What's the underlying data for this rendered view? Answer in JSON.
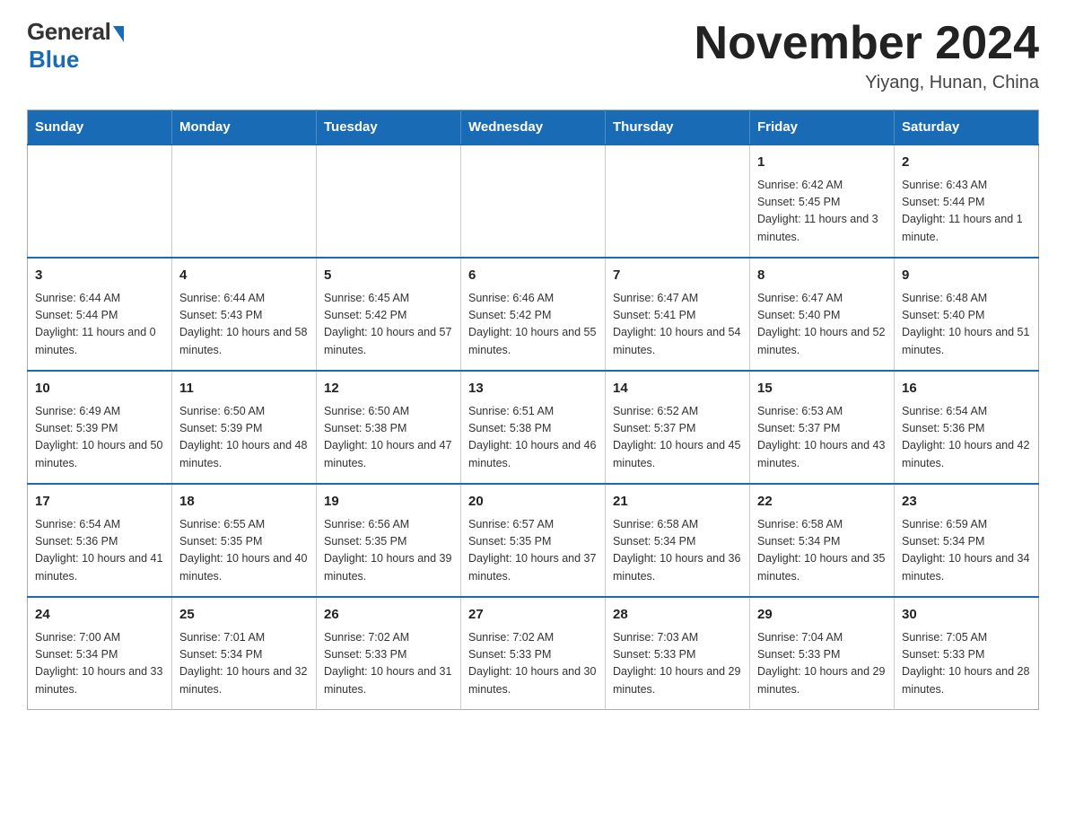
{
  "header": {
    "logo_general": "General",
    "logo_blue": "Blue",
    "month_title": "November 2024",
    "location": "Yiyang, Hunan, China"
  },
  "weekdays": [
    "Sunday",
    "Monday",
    "Tuesday",
    "Wednesday",
    "Thursday",
    "Friday",
    "Saturday"
  ],
  "weeks": [
    [
      {
        "day": "",
        "info": ""
      },
      {
        "day": "",
        "info": ""
      },
      {
        "day": "",
        "info": ""
      },
      {
        "day": "",
        "info": ""
      },
      {
        "day": "",
        "info": ""
      },
      {
        "day": "1",
        "info": "Sunrise: 6:42 AM\nSunset: 5:45 PM\nDaylight: 11 hours and 3 minutes."
      },
      {
        "day": "2",
        "info": "Sunrise: 6:43 AM\nSunset: 5:44 PM\nDaylight: 11 hours and 1 minute."
      }
    ],
    [
      {
        "day": "3",
        "info": "Sunrise: 6:44 AM\nSunset: 5:44 PM\nDaylight: 11 hours and 0 minutes."
      },
      {
        "day": "4",
        "info": "Sunrise: 6:44 AM\nSunset: 5:43 PM\nDaylight: 10 hours and 58 minutes."
      },
      {
        "day": "5",
        "info": "Sunrise: 6:45 AM\nSunset: 5:42 PM\nDaylight: 10 hours and 57 minutes."
      },
      {
        "day": "6",
        "info": "Sunrise: 6:46 AM\nSunset: 5:42 PM\nDaylight: 10 hours and 55 minutes."
      },
      {
        "day": "7",
        "info": "Sunrise: 6:47 AM\nSunset: 5:41 PM\nDaylight: 10 hours and 54 minutes."
      },
      {
        "day": "8",
        "info": "Sunrise: 6:47 AM\nSunset: 5:40 PM\nDaylight: 10 hours and 52 minutes."
      },
      {
        "day": "9",
        "info": "Sunrise: 6:48 AM\nSunset: 5:40 PM\nDaylight: 10 hours and 51 minutes."
      }
    ],
    [
      {
        "day": "10",
        "info": "Sunrise: 6:49 AM\nSunset: 5:39 PM\nDaylight: 10 hours and 50 minutes."
      },
      {
        "day": "11",
        "info": "Sunrise: 6:50 AM\nSunset: 5:39 PM\nDaylight: 10 hours and 48 minutes."
      },
      {
        "day": "12",
        "info": "Sunrise: 6:50 AM\nSunset: 5:38 PM\nDaylight: 10 hours and 47 minutes."
      },
      {
        "day": "13",
        "info": "Sunrise: 6:51 AM\nSunset: 5:38 PM\nDaylight: 10 hours and 46 minutes."
      },
      {
        "day": "14",
        "info": "Sunrise: 6:52 AM\nSunset: 5:37 PM\nDaylight: 10 hours and 45 minutes."
      },
      {
        "day": "15",
        "info": "Sunrise: 6:53 AM\nSunset: 5:37 PM\nDaylight: 10 hours and 43 minutes."
      },
      {
        "day": "16",
        "info": "Sunrise: 6:54 AM\nSunset: 5:36 PM\nDaylight: 10 hours and 42 minutes."
      }
    ],
    [
      {
        "day": "17",
        "info": "Sunrise: 6:54 AM\nSunset: 5:36 PM\nDaylight: 10 hours and 41 minutes."
      },
      {
        "day": "18",
        "info": "Sunrise: 6:55 AM\nSunset: 5:35 PM\nDaylight: 10 hours and 40 minutes."
      },
      {
        "day": "19",
        "info": "Sunrise: 6:56 AM\nSunset: 5:35 PM\nDaylight: 10 hours and 39 minutes."
      },
      {
        "day": "20",
        "info": "Sunrise: 6:57 AM\nSunset: 5:35 PM\nDaylight: 10 hours and 37 minutes."
      },
      {
        "day": "21",
        "info": "Sunrise: 6:58 AM\nSunset: 5:34 PM\nDaylight: 10 hours and 36 minutes."
      },
      {
        "day": "22",
        "info": "Sunrise: 6:58 AM\nSunset: 5:34 PM\nDaylight: 10 hours and 35 minutes."
      },
      {
        "day": "23",
        "info": "Sunrise: 6:59 AM\nSunset: 5:34 PM\nDaylight: 10 hours and 34 minutes."
      }
    ],
    [
      {
        "day": "24",
        "info": "Sunrise: 7:00 AM\nSunset: 5:34 PM\nDaylight: 10 hours and 33 minutes."
      },
      {
        "day": "25",
        "info": "Sunrise: 7:01 AM\nSunset: 5:34 PM\nDaylight: 10 hours and 32 minutes."
      },
      {
        "day": "26",
        "info": "Sunrise: 7:02 AM\nSunset: 5:33 PM\nDaylight: 10 hours and 31 minutes."
      },
      {
        "day": "27",
        "info": "Sunrise: 7:02 AM\nSunset: 5:33 PM\nDaylight: 10 hours and 30 minutes."
      },
      {
        "day": "28",
        "info": "Sunrise: 7:03 AM\nSunset: 5:33 PM\nDaylight: 10 hours and 29 minutes."
      },
      {
        "day": "29",
        "info": "Sunrise: 7:04 AM\nSunset: 5:33 PM\nDaylight: 10 hours and 29 minutes."
      },
      {
        "day": "30",
        "info": "Sunrise: 7:05 AM\nSunset: 5:33 PM\nDaylight: 10 hours and 28 minutes."
      }
    ]
  ]
}
